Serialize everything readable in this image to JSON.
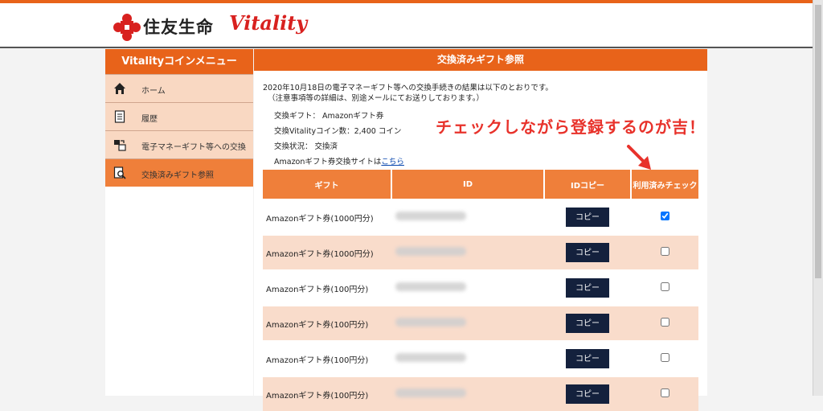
{
  "brand": {
    "name": "住友生命",
    "sub": "Vitality"
  },
  "sidebar": {
    "title": "Vitalityコインメニュー",
    "items": [
      {
        "label": "ホーム",
        "icon": "home-icon"
      },
      {
        "label": "履歴",
        "icon": "document-icon"
      },
      {
        "label": "電子マネーギフト等への交換",
        "icon": "exchange-icon"
      },
      {
        "label": "交換済みギフト参照",
        "icon": "search-document-icon",
        "active": true
      }
    ]
  },
  "main": {
    "title": "交換済みギフト参照",
    "intro_line1": "2020年10月18日の電子マネーギフト等への交換手続きの結果は以下のとおりです。",
    "intro_line2": "（注意事項等の詳細は、別途メールにてお送りしております。）",
    "gift_line": "交換ギフト：  Amazonギフト券",
    "coins_line": "交換Vitalityコイン数：2,400 コイン",
    "status_line": "交換状況：  交換済",
    "site_prefix": "Amazonギフト券交換サイトは",
    "site_link": "こちら"
  },
  "annotation": "チェックしながら登録するのが吉！",
  "table": {
    "headers": [
      "ギフト",
      "ID",
      "IDコピー",
      "利用済みチェック"
    ],
    "copy_label": "コピー",
    "rows": [
      {
        "gift": "Amazonギフト券(1000円分)",
        "checked": true
      },
      {
        "gift": "Amazonギフト券(1000円分)",
        "checked": false
      },
      {
        "gift": "Amazonギフト券(100円分)",
        "checked": false
      },
      {
        "gift": "Amazonギフト券(100円分)",
        "checked": false
      },
      {
        "gift": "Amazonギフト券(100円分)",
        "checked": false
      },
      {
        "gift": "Amazonギフト券(100円分)",
        "checked": false
      }
    ]
  },
  "colors": {
    "accent": "#e8631a",
    "row_alt": "#f9dccb",
    "copy_button": "#14213d",
    "annotation": "#e8322b"
  }
}
